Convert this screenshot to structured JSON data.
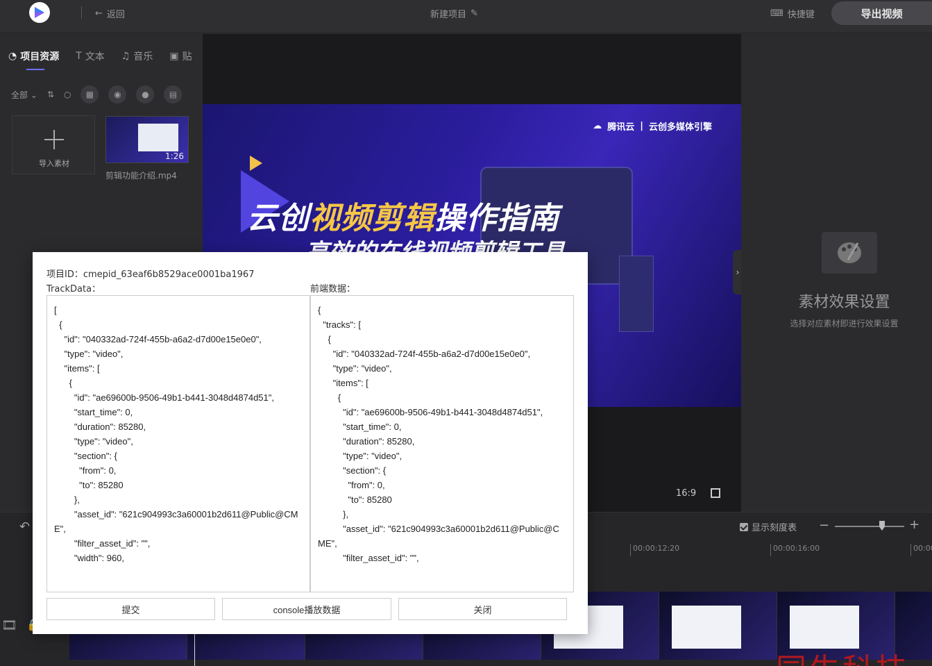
{
  "header": {
    "back_label": "返回",
    "project_title": "新建项目",
    "shortcut_label": "快捷键",
    "export_label": "导出视频"
  },
  "left_panel": {
    "tabs": [
      {
        "label": "项目资源",
        "icon": "project-resource-icon"
      },
      {
        "label": "文本",
        "icon": "text-icon"
      },
      {
        "label": "音乐",
        "icon": "music-icon"
      },
      {
        "label": "贴",
        "icon": "image-icon"
      }
    ],
    "filter_label": "全部",
    "import_label": "导入素材",
    "media": {
      "name": "剪辑功能介绍.mp4",
      "duration": "1:26"
    }
  },
  "preview": {
    "brand_left": "腾讯云",
    "brand_right": "云创多媒体引擎",
    "title_part1": "云创",
    "title_highlight": "视频剪辑",
    "title_part2": "操作指南",
    "subtitle": "高效的在线视频剪辑工具",
    "ratio": "16:9"
  },
  "right_panel": {
    "title": "素材效果设置",
    "subtitle": "选择对应素材即进行效果设置"
  },
  "timeline": {
    "show_scale_label": "显示刻度表",
    "ticks": [
      "00:00:12:20",
      "00:00:16:00",
      "00:00"
    ],
    "zoom_level": 0.68
  },
  "modal": {
    "project_id_label": "项目ID：",
    "project_id": "cmepid_63eaf6b8529ace0001ba1967",
    "trackdata_label": "TrackData：",
    "frontend_label": "前端数据：",
    "trackdata_text": "[\n  {\n    \"id\": \"040332ad-724f-455b-a6a2-d7d00e15e0e0\",\n    \"type\": \"video\",\n    \"items\": [\n      {\n        \"id\": \"ae69600b-9506-49b1-b441-3048d4874d51\",\n        \"start_time\": 0,\n        \"duration\": 85280,\n        \"type\": \"video\",\n        \"section\": {\n          \"from\": 0,\n          \"to\": 85280\n        },\n        \"asset_id\": \"621c904993c3a60001b2d611@Public@CME\",\n        \"filter_asset_id\": \"\",\n        \"width\": 960,",
    "frontend_text": "{\n  \"tracks\": [\n    {\n      \"id\": \"040332ad-724f-455b-a6a2-d7d00e15e0e0\",\n      \"type\": \"video\",\n      \"items\": [\n        {\n          \"id\": \"ae69600b-9506-49b1-b441-3048d4874d51\",\n          \"start_time\": 0,\n          \"duration\": 85280,\n          \"type\": \"video\",\n          \"section\": {\n            \"from\": 0,\n            \"to\": 85280\n          },\n          \"asset_id\": \"621c904993c3a60001b2d611@Public@CME\",\n          \"filter_asset_id\": \"\",",
    "submit_label": "提交",
    "console_label": "console播放数据",
    "close_label": "关闭"
  },
  "watermark": "同生科技",
  "colors": {
    "accent": "#6e6ef5",
    "highlight": "#f6c745",
    "watermark": "#b1191e"
  }
}
